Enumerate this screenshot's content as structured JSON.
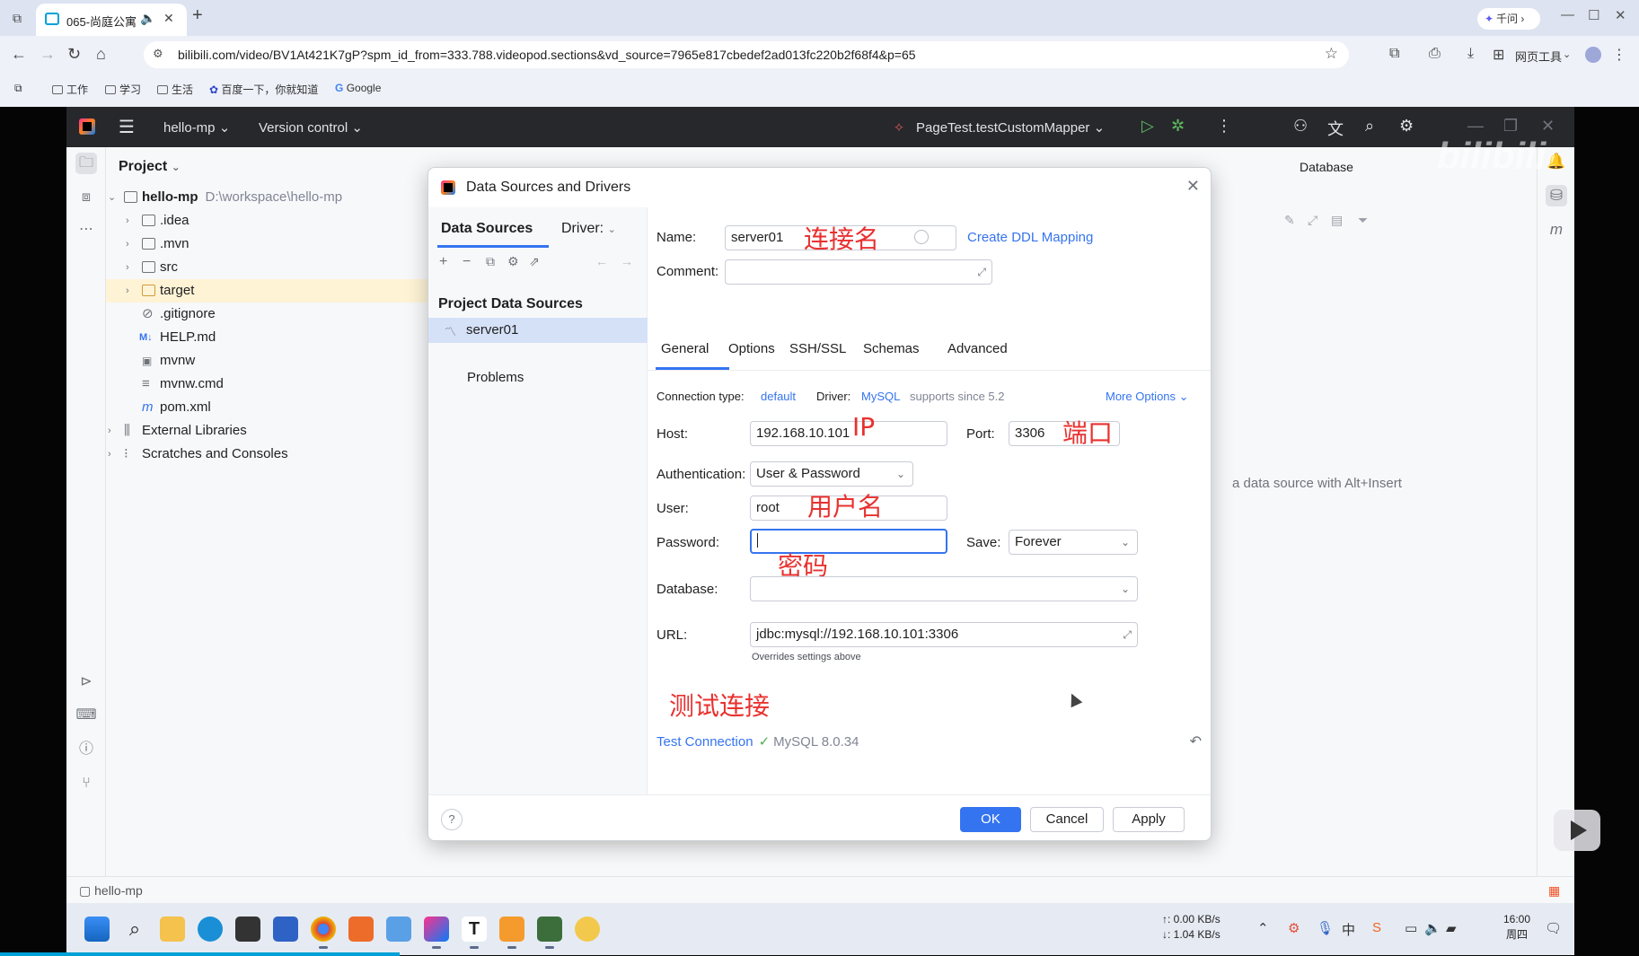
{
  "browser": {
    "tab_title": "065-尚庭公寓",
    "qianwen_label": "千问",
    "url": "bilibili.com/video/BV1At421K7gP?spm_id_from=333.788.videopod.sections&vd_source=7965e817cbedef2ad013fc220b2f68f4&p=65",
    "tools_label": "网页工具",
    "bookmarks": [
      "工作",
      "学习",
      "生活",
      "百度一下，你就知道",
      "Google"
    ]
  },
  "ide": {
    "project_name": "hello-mp",
    "vcs_label": "Version control",
    "run_config": "PageTest.testCustomMapper",
    "panel_title": "Project",
    "tree": [
      {
        "label": "hello-mp",
        "path": "D:\\workspace\\hello-mp"
      },
      {
        "label": ".idea"
      },
      {
        "label": ".mvn"
      },
      {
        "label": "src"
      },
      {
        "label": "target"
      },
      {
        "label": ".gitignore"
      },
      {
        "label": "HELP.md"
      },
      {
        "label": "mvnw"
      },
      {
        "label": "mvnw.cmd"
      },
      {
        "label": "pom.xml"
      },
      {
        "label": "External Libraries"
      },
      {
        "label": "Scratches and Consoles"
      }
    ],
    "database_title": "Database",
    "db_hint": "a data source with Alt+Insert",
    "status_crumb": "hello-mp"
  },
  "dialog": {
    "title": "Data Sources and Drivers",
    "tab_data_sources": "Data Sources",
    "tab_drivers": "Driver:",
    "project_data_sources_label": "Project Data Sources",
    "selected_source": "server01",
    "problems_label": "Problems",
    "name_label": "Name:",
    "name_value": "server01",
    "create_ddl": "Create DDL Mapping",
    "comment_label": "Comment:",
    "subtabs": [
      "General",
      "Options",
      "SSH/SSL",
      "Schemas",
      "Advanced"
    ],
    "connection_type_label": "Connection type:",
    "connection_type_value": "default",
    "driver_label": "Driver:",
    "driver_value": "MySQL",
    "driver_note": "supports since 5.2",
    "more_options": "More Options",
    "host_label": "Host:",
    "host_value": "192.168.10.101",
    "port_label": "Port:",
    "port_value": "3306",
    "auth_label": "Authentication:",
    "auth_value": "User & Password",
    "user_label": "User:",
    "user_value": "root",
    "password_label": "Password:",
    "password_value": "",
    "save_label": "Save:",
    "save_value": "Forever",
    "database_label": "Database:",
    "database_value": "",
    "url_label": "URL:",
    "url_value": "jdbc:mysql://192.168.10.101:3306",
    "url_note": "Overrides settings above",
    "test_connection": "Test Connection",
    "test_result": "MySQL 8.0.34",
    "ok": "OK",
    "cancel": "Cancel",
    "apply": "Apply"
  },
  "annotations": {
    "name": "连接名",
    "ip": "IP",
    "port": "端口",
    "user": "用户名",
    "password": "密码",
    "test": "测试连接"
  },
  "taskbar": {
    "net_up": "↑: 0.00 KB/s",
    "net_down": "↓: 1.04 KB/s",
    "time": "16:00",
    "day": "周四"
  },
  "colors": {
    "accent": "#3574f0",
    "annotation_red": "#e8312f",
    "ide_header": "#27282c",
    "bilibili_blue": "#00a1d6"
  }
}
